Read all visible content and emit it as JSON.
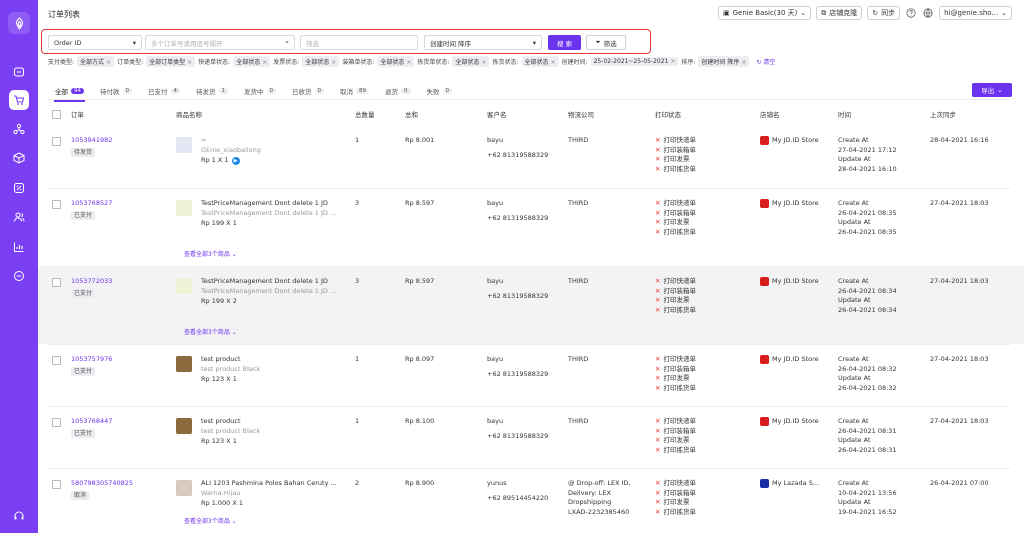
{
  "header": {
    "title": "订单列表",
    "plan": "Genie Basic(30 天)",
    "shop_clone": "店铺克隆",
    "sync": "同步",
    "user": "hi@genie.sho..."
  },
  "search": {
    "field_type": "Order ID",
    "order_placeholder": "多个订单号请用逗号隔开",
    "second_placeholder": "筛选",
    "sort": "创建时间 降序",
    "search_btn": "搜 索",
    "filter_btn": "筛选"
  },
  "filters": {
    "items": [
      {
        "label": "支付类型:",
        "value": "全部方式"
      },
      {
        "label": "订单类型:",
        "value": "全部订单类型"
      },
      {
        "label": "快递单状态:",
        "value": "全部状态"
      },
      {
        "label": "发票状态:",
        "value": "全部状态"
      },
      {
        "label": "装箱单状态:",
        "value": "全部状态"
      },
      {
        "label": "拣货单状态:",
        "value": "全部状态"
      },
      {
        "label": "拣货状态:",
        "value": "全部状态"
      },
      {
        "label": "创建时间:",
        "value": "25-02-2021~25-05-2021"
      },
      {
        "label": "排序:",
        "value": "创建时间 降序"
      }
    ],
    "clear": "清空"
  },
  "tabs": [
    {
      "label": "全部",
      "count": "94"
    },
    {
      "label": "待付款",
      "count": "0"
    },
    {
      "label": "已支付",
      "count": "4"
    },
    {
      "label": "待发货",
      "count": "1"
    },
    {
      "label": "发货中",
      "count": "0"
    },
    {
      "label": "已收货",
      "count": "0"
    },
    {
      "label": "取消",
      "count": "89"
    },
    {
      "label": "退货",
      "count": "0"
    },
    {
      "label": "失败",
      "count": "0"
    }
  ],
  "export_label": "导出",
  "columns": [
    "订单",
    "商品名称",
    "总数量",
    "总和",
    "客户名",
    "物流公司",
    "打印状态",
    "店铺名",
    "时间",
    "上次同步"
  ],
  "print_labels": [
    "打印快递单",
    "打印装箱单",
    "打印发票",
    "打印拣货单"
  ],
  "orders": [
    {
      "id": "1053941982",
      "status": "待发货",
      "product": "~",
      "variant": "GEnie_xiaobailong",
      "price": "Rp 1 X 1",
      "qty": "1",
      "total": "Rp 8.001",
      "customer": "bayu",
      "phone": "+62 81319588329",
      "logistics": [
        "THIRD"
      ],
      "shop": "My JD.ID Store",
      "time": [
        "Create At",
        "27-04-2021 17:12",
        "Update At",
        "28-04-2021 16:10"
      ],
      "sync": "28-04-2021 16:16",
      "more": ""
    },
    {
      "id": "1053768527",
      "status": "已支付",
      "product": "TestPriceManagement Dont delete 1 JD",
      "variant": "TestPriceManagement Dont delete 1 JD ...",
      "price": "Rp 199 X 1",
      "qty": "3",
      "total": "Rp 8.597",
      "customer": "bayu",
      "phone": "+62 81319588329",
      "logistics": [
        "THIRD"
      ],
      "shop": "My JD.ID Store",
      "time": [
        "Create At",
        "26-04-2021 08:35",
        "Update At",
        "26-04-2021 08:35"
      ],
      "sync": "27-04-2021 18:03",
      "more": "查看全部3个商品"
    },
    {
      "id": "1053772033",
      "status": "已支付",
      "product": "TestPriceManagement Dont delete 1 JD",
      "variant": "TestPriceManagement Dont delete 1 JD ...",
      "price": "Rp 199 X 2",
      "qty": "3",
      "total": "Rp 8.597",
      "customer": "bayu",
      "phone": "+62 81319588329",
      "logistics": [
        "THIRD"
      ],
      "shop": "My JD.ID Store",
      "time": [
        "Create At",
        "26-04-2021 08:34",
        "Update At",
        "26-04-2021 08:34"
      ],
      "sync": "27-04-2021 18:03",
      "more": "查看全部3个商品"
    },
    {
      "id": "1053757976",
      "status": "已支付",
      "product": "test product",
      "variant": "test product Black",
      "price": "Rp 123 X 1",
      "qty": "1",
      "total": "Rp 8.097",
      "customer": "bayu",
      "phone": "+62 81319588329",
      "logistics": [
        "THIRD"
      ],
      "shop": "My JD.ID Store",
      "time": [
        "Create At",
        "26-04-2021 08:32",
        "Update At",
        "26-04-2021 08:32"
      ],
      "sync": "27-04-2021 18:03",
      "more": ""
    },
    {
      "id": "1053768447",
      "status": "已支付",
      "product": "test product",
      "variant": "test product Black",
      "price": "Rp 123 X 1",
      "qty": "1",
      "total": "Rp 8.100",
      "customer": "bayu",
      "phone": "+62 81319588329",
      "logistics": [
        "THIRD"
      ],
      "shop": "My JD.ID Store",
      "time": [
        "Create At",
        "26-04-2021 08:31",
        "Update At",
        "26-04-2021 08:31"
      ],
      "sync": "27-04-2021 18:03",
      "more": ""
    },
    {
      "id": "580798305740825",
      "status": "取消",
      "product": "ALI 1203 Pashmina Polos Bahan Ceruty ...",
      "variant": "Warna:Hijau",
      "price": "Rp 1.000 X 1",
      "qty": "2",
      "total": "Rp 8.900",
      "customer": "yunus",
      "phone": "+62 89514454220",
      "logistics": [
        "@ Drop-off: LEX ID,",
        "Delivery: LEX",
        "Dropshipping",
        "LXAD-2232385460"
      ],
      "shop": "My Lazada S...",
      "time": [
        "Create At",
        "10-04-2021 13:56",
        "Update At",
        "19-04-2021 16:52"
      ],
      "sync": "26-04-2021 07:00",
      "more": "查看全部3个商品"
    }
  ],
  "colors": {
    "accent": "#6b33ee",
    "sidebar": "#7a3ff2",
    "error": "#e53935"
  }
}
